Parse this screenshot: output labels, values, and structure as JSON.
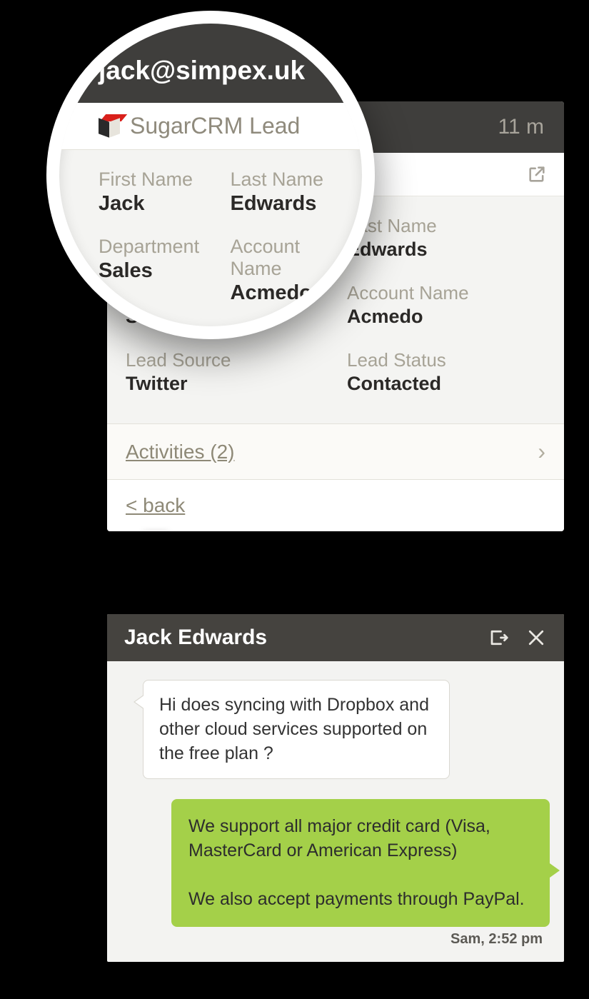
{
  "card": {
    "age": "11 m",
    "source_label": "SugarCRM Lead",
    "fields": {
      "first_name_label": "First Name",
      "first_name": "Jack",
      "last_name_label": "Last Name",
      "last_name": "Edwards",
      "department_label": "Department",
      "department": "Sales",
      "account_name_label": "Account Name",
      "account_name": "Acmedo",
      "lead_source_label": "Lead Source",
      "lead_source": "Twitter",
      "lead_status_label": "Lead Status",
      "lead_status": "Contacted"
    },
    "activities_label": "Activities (2)",
    "back_label": "< back"
  },
  "lens": {
    "email": "jack@simpex.uk",
    "source_label": "SugarCRM Lead",
    "first_name_label": "First Name",
    "first_name": "Jack",
    "last_name_label": "Last Name",
    "last_name": "Edwards",
    "department_label": "Department",
    "department": "Sales",
    "account_label": "Account Name",
    "account": "Acmedo",
    "lead_source_label": "Lead Source",
    "lead_source": "Twitter"
  },
  "chat": {
    "title": "Jack Edwards",
    "incoming": "Hi does syncing with Dropbox and other cloud services supported on the free plan ?",
    "outgoing": "We support all major credit card (Visa, MasterCard or American Express)\n\nWe also accept payments through PayPal.",
    "timestamp": "Sam, 2:52 pm"
  }
}
